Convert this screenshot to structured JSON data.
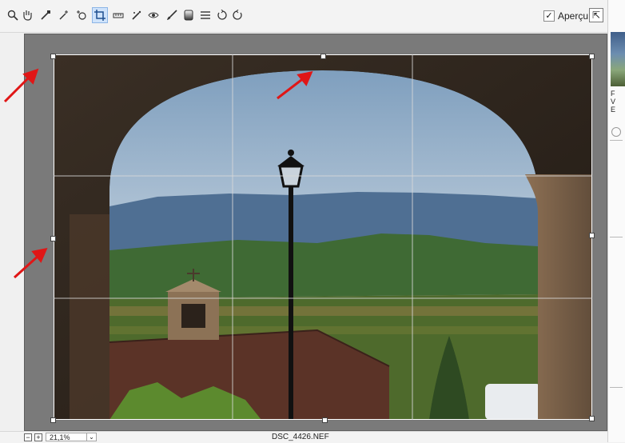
{
  "toolbar": {
    "preview_label": "Aperçu",
    "preview_checked": "✓",
    "icons": [
      "zoom-icon",
      "hand-icon",
      "white-balance-icon",
      "color-sampler-icon",
      "targeted-adjustment-icon",
      "crop-icon",
      "straighten-icon",
      "spot-removal-icon",
      "red-eye-icon",
      "adjustment-brush-icon",
      "graduated-filter-icon",
      "preferences-icon",
      "rotate-left-icon",
      "rotate-right-icon"
    ]
  },
  "status": {
    "zoom_value": "21,1%",
    "filename": "DSC_4426.NEF"
  },
  "colors": {
    "arrow": "#e01616",
    "crop_border": "#ffffff",
    "grid": "#d9d9d9"
  }
}
